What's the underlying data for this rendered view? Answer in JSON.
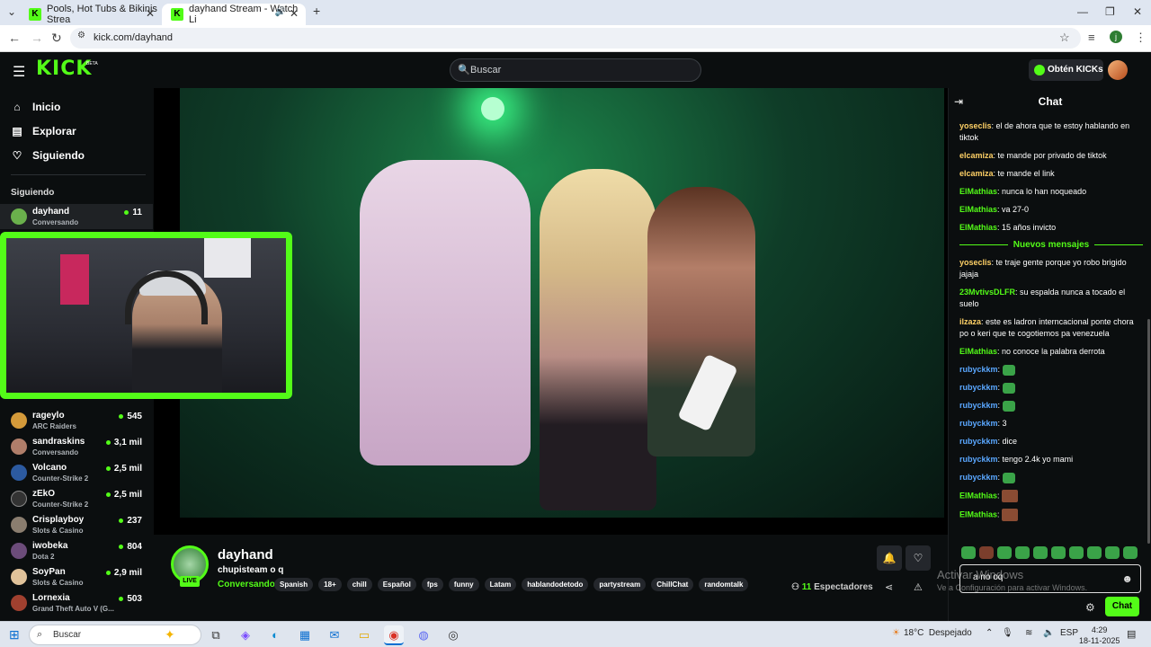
{
  "browser": {
    "tabs": [
      {
        "title": "Pools, Hot Tubs & Bikinis Strea"
      },
      {
        "title": "dayhand Stream - Watch Li"
      }
    ],
    "new_tab_icon": "+",
    "url": "kick.com/dayhand"
  },
  "header": {
    "logo": "KICK",
    "beta": "BETA",
    "search_placeholder": "Buscar",
    "get_kicks": "Obtén KICKs"
  },
  "nav": {
    "items": [
      {
        "label": "Inicio",
        "icon": "home-icon"
      },
      {
        "label": "Explorar",
        "icon": "compass-icon"
      },
      {
        "label": "Siguiendo",
        "icon": "heart-icon"
      }
    ],
    "following_title": "Siguiendo"
  },
  "following": [
    {
      "name": "dayhand",
      "category": "Conversando",
      "viewers": "11",
      "color": "#6ab04c"
    },
    {
      "name": "rageylo",
      "category": "ARC Raiders",
      "viewers": "545",
      "color": "#d49a3a"
    },
    {
      "name": "sandraskins",
      "category": "Conversando",
      "viewers": "3,1 mil",
      "color": "#b07e6a"
    },
    {
      "name": "Volcano",
      "category": "Counter-Strike 2",
      "viewers": "2,5 mil",
      "color": "#2c5aa0"
    },
    {
      "name": "zEkO",
      "category": "Counter-Strike 2",
      "viewers": "2,5 mil",
      "color": "#333333"
    },
    {
      "name": "Crisplayboy",
      "category": "Slots & Casino",
      "viewers": "237",
      "color": "#8a7d6f"
    },
    {
      "name": "iwobeka",
      "category": "Dota 2",
      "viewers": "804",
      "color": "#6c4c7a"
    },
    {
      "name": "SoyPan",
      "category": "Slots & Casino",
      "viewers": "2,9 mil",
      "color": "#e0c29a"
    },
    {
      "name": "Lornexia",
      "category": "Grand Theft Auto V (G...",
      "viewers": "503",
      "color": "#a0402f"
    }
  ],
  "stream": {
    "streamer": "dayhand",
    "title": "chupisteam o q",
    "category": "Conversando",
    "live": "LIVE",
    "tags": [
      "Spanish",
      "18+",
      "chill",
      "Español",
      "fps",
      "funny",
      "Latam",
      "hablandodetodo",
      "partystream",
      "ChillChat",
      "randomtalk"
    ],
    "viewers_count": "11",
    "viewers_label": "Espectadores"
  },
  "chat": {
    "title": "Chat",
    "new_messages": "Nuevos mensajes",
    "messages_before": [
      {
        "user": "yoseclis",
        "color": "#ffd166",
        "text": "el de ahora que te estoy hablando en tiktok"
      },
      {
        "user": "elcamiza",
        "color": "#ffd166",
        "text": "te mande por privado de tiktok"
      },
      {
        "user": "elcamiza",
        "color": "#ffd166",
        "text": "te mande el link"
      },
      {
        "user": "ElMathias",
        "color": "#53fc18",
        "text": "nunca lo han noqueado"
      },
      {
        "user": "ElMathias",
        "color": "#53fc18",
        "text": "va 27-0"
      },
      {
        "user": "ElMathias",
        "color": "#53fc18",
        "text": "15 años invicto"
      }
    ],
    "messages_after": [
      {
        "user": "yoseclis",
        "color": "#ffd166",
        "text": "te traje gente porque yo robo brigido jajaja"
      },
      {
        "user": "23MvtivsDLFR",
        "color": "#53fc18",
        "text": "su espalda nunca a tocado el suelo"
      },
      {
        "user": "ilzaza",
        "color": "#ffd166",
        "text": "este es ladron interncacional ponte chora po o keri que te cogotiemos pa venezuela"
      },
      {
        "user": "ElMathias",
        "color": "#53fc18",
        "text": "no conoce la palabra derrota"
      },
      {
        "user": "rubyckkm",
        "color": "#5aa7ff",
        "text": "",
        "emote": "emote"
      },
      {
        "user": "rubyckkm",
        "color": "#5aa7ff",
        "text": "",
        "emote": "emote"
      },
      {
        "user": "rubyckkm",
        "color": "#5aa7ff",
        "text": "",
        "emote": "emote"
      },
      {
        "user": "rubyckkm",
        "color": "#5aa7ff",
        "text": "3"
      },
      {
        "user": "rubyckkm",
        "color": "#5aa7ff",
        "text": "dice"
      },
      {
        "user": "rubyckkm",
        "color": "#5aa7ff",
        "text": "tengo 2.4k yo mami"
      },
      {
        "user": "rubyckkm",
        "color": "#5aa7ff",
        "text": "",
        "emote": "emote"
      },
      {
        "user": "ElMathias",
        "color": "#53fc18",
        "text": "",
        "emote": "emote2"
      },
      {
        "user": "ElMathias",
        "color": "#53fc18",
        "text": "",
        "emote": "emote2"
      }
    ],
    "input_value": "a no oq",
    "send_label": "Chat"
  },
  "watermark": {
    "line1": "Activar Windows",
    "line2": "Ve a Configuración para activar Windows."
  },
  "taskbar": {
    "search_placeholder": "Buscar",
    "temperature": "18°C",
    "weather": "Despejado",
    "lang": "ESP",
    "time": "4:29",
    "date": "18-11-2025"
  }
}
